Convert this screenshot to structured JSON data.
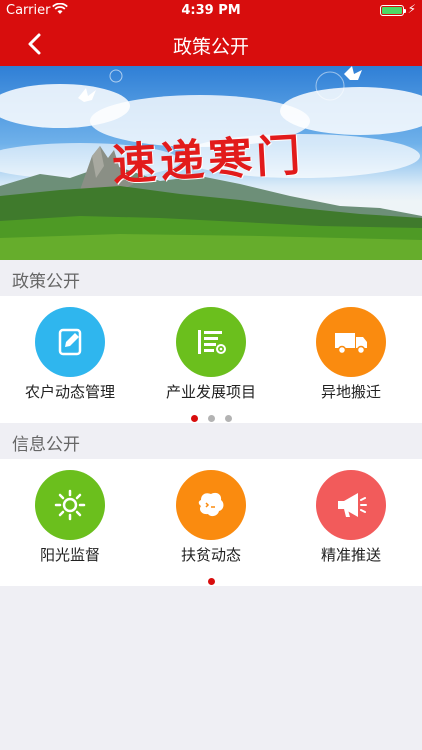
{
  "status_bar": {
    "carrier": "Carrier",
    "time": "4:39 PM",
    "battery_level": 1.0
  },
  "nav": {
    "title": "政策公开",
    "back_icon": "chevron-left-icon"
  },
  "banner": {
    "text": "速递寒门"
  },
  "policy_section": {
    "header": "政策公开",
    "items": [
      {
        "label": "农户动态管理",
        "icon": "edit-note-icon",
        "color": "#2fb6ee"
      },
      {
        "label": "产业发展项目",
        "icon": "list-settings-icon",
        "color": "#6bbf1d"
      },
      {
        "label": "异地搬迁",
        "icon": "truck-icon",
        "color": "#fa8b0f"
      }
    ],
    "page_count": 3,
    "active_page": 0
  },
  "info_section": {
    "header": "信息公开",
    "items": [
      {
        "label": "阳光监督",
        "icon": "sun-icon",
        "color": "#6bbf1d"
      },
      {
        "label": "扶贫动态",
        "icon": "chat-bubble-icon",
        "color": "#fa8b0f"
      },
      {
        "label": "精准推送",
        "icon": "megaphone-icon",
        "color": "#f25b5b"
      }
    ],
    "page_count": 1,
    "active_page": 0
  },
  "colors": {
    "brand_red": "#d80d0d",
    "background": "#efeff4"
  }
}
